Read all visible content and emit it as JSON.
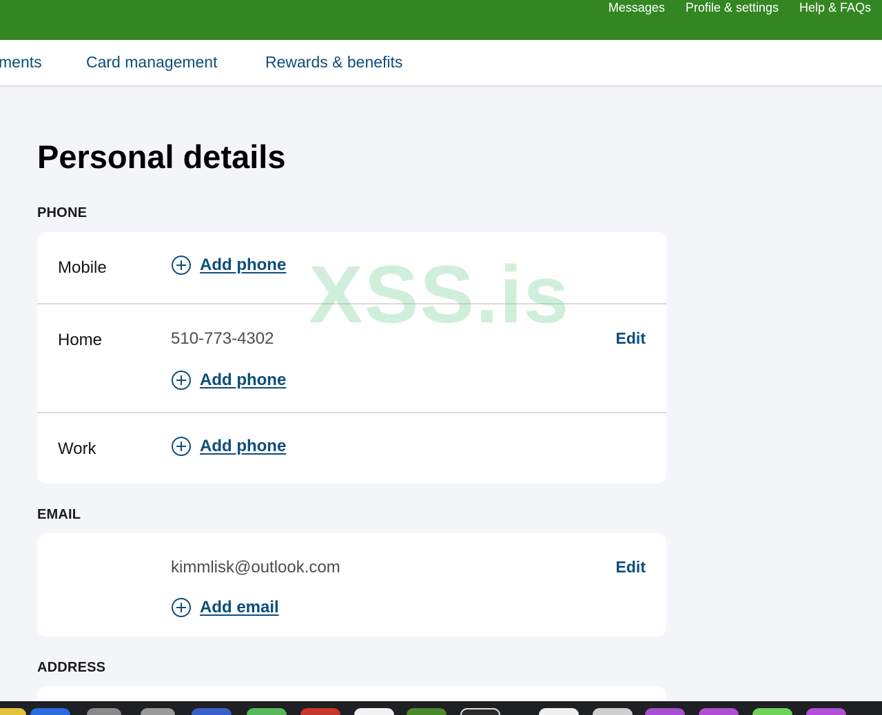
{
  "topbar": {
    "links": [
      "Messages",
      "Profile & settings",
      "Help & FAQs"
    ]
  },
  "subnav": {
    "tabs": [
      "ments",
      "Card management",
      "Rewards & benefits"
    ]
  },
  "page": {
    "title": "Personal details",
    "watermark": "XSS.is"
  },
  "phone": {
    "section_label": "PHONE",
    "rows": [
      {
        "label": "Mobile",
        "value": "",
        "add_label": "Add phone"
      },
      {
        "label": "Home",
        "value": "510-773-4302",
        "edit_label": "Edit",
        "add_label": "Add phone"
      },
      {
        "label": "Work",
        "value": "",
        "add_label": "Add phone"
      }
    ]
  },
  "email": {
    "section_label": "EMAIL",
    "value": "kimmlisk@outlook.com",
    "edit_label": "Edit",
    "add_label": "Add email"
  },
  "address": {
    "section_label": "ADDRESS"
  },
  "colors": {
    "brand_green": "#338622",
    "link_blue": "#0d4d7a",
    "page_bg": "#f4f5f8"
  }
}
